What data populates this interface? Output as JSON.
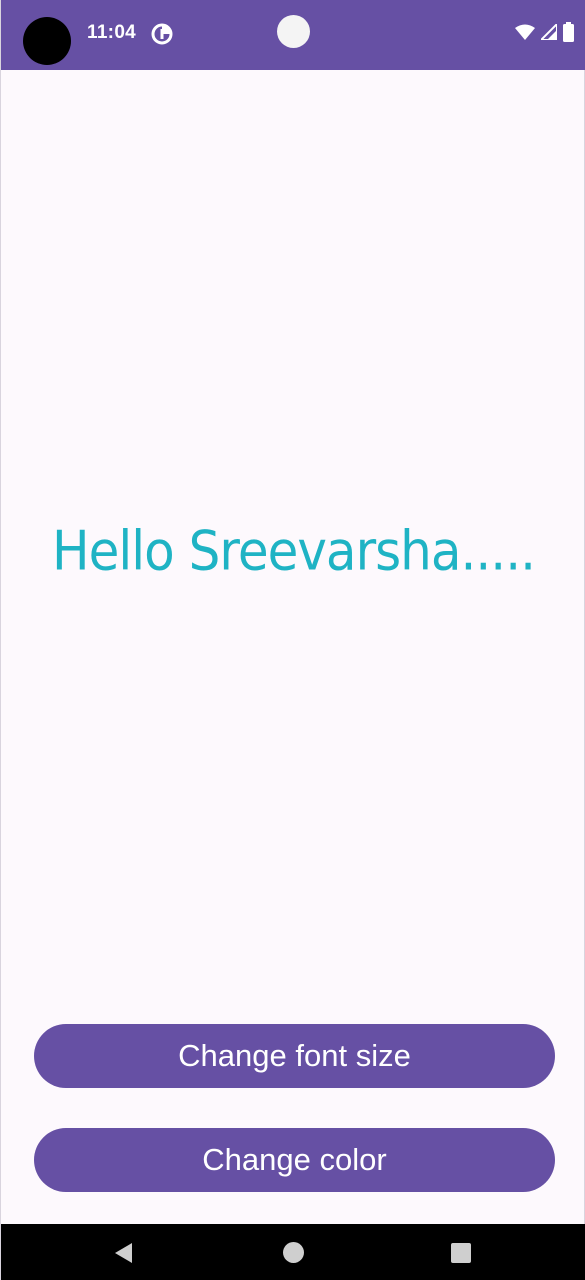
{
  "status_bar": {
    "time": "11:04",
    "notification_icon": "data-saver-icon",
    "icons": [
      "wifi-icon",
      "signal-icon",
      "battery-icon"
    ]
  },
  "main": {
    "greeting": "Hello Sreevarsha....."
  },
  "buttons": {
    "change_font_size": "Change font size",
    "change_color": "Change color"
  },
  "nav_bar": {
    "icons": [
      "back-icon",
      "home-icon",
      "recents-icon"
    ]
  },
  "colors": {
    "primary": "#6650a4",
    "greeting_text": "#1fb3c4",
    "background": "#fdf9fd"
  }
}
